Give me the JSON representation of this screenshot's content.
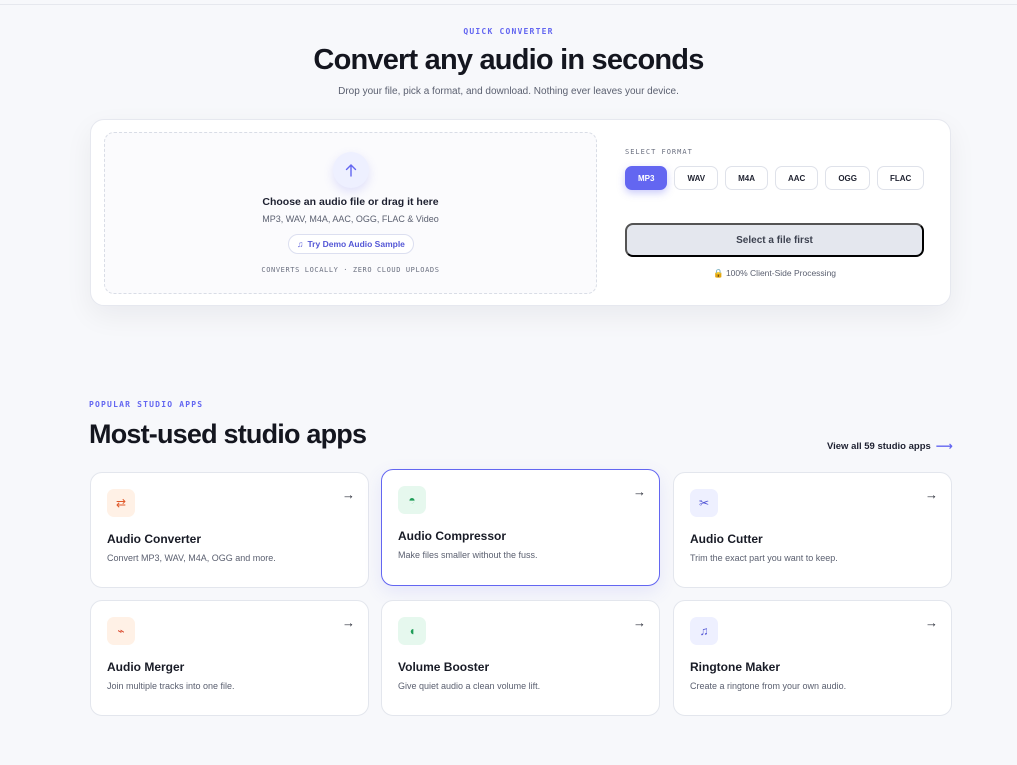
{
  "converter": {
    "eyebrow": "QUICK CONVERTER",
    "title": "Convert any audio in seconds",
    "subtitle": "Drop your file, pick a format, and download. Nothing ever leaves your device.",
    "dropzone": {
      "upload_icon": "up-arrow-icon",
      "title": "Choose an audio file or drag it here",
      "formats": "MP3, WAV, M4A, AAC, OGG, FLAC & Video",
      "demo_label": "Try Demo Audio Sample",
      "demo_icon": "music-note-icon",
      "note": "CONVERTS LOCALLY · ZERO CLOUD UPLOADS"
    },
    "format_label": "SELECT FORMAT",
    "formats": [
      "MP3",
      "WAV",
      "M4A",
      "AAC",
      "OGG",
      "FLAC"
    ],
    "selected_format": "MP3",
    "action_label": "Select a file first",
    "client_note": "100% Client-Side Processing",
    "client_icon": "lock-icon",
    "accent": "#6366f1"
  },
  "apps": {
    "eyebrow": "POPULAR STUDIO APPS",
    "title": "Most-used studio apps",
    "view_all": "View all 59 studio apps",
    "items": [
      {
        "name": "Audio Converter",
        "desc": "Convert MP3, WAV, M4A, OGG and more.",
        "icon": "swap-arrows-icon",
        "glyph": "⇄",
        "bg": "#fff1e6",
        "fg": "#e0592a"
      },
      {
        "name": "Audio Compressor",
        "desc": "Make files smaller without the fuss.",
        "icon": "compress-icon",
        "glyph": "◓",
        "bg": "#e6f8ee",
        "fg": "#1f9d58"
      },
      {
        "name": "Audio Cutter",
        "desc": "Trim the exact part you want to keep.",
        "icon": "scissors-icon",
        "glyph": "✂",
        "bg": "#eef0ff",
        "fg": "#5457d6"
      },
      {
        "name": "Audio Merger",
        "desc": "Join multiple tracks into one file.",
        "icon": "merge-icon",
        "glyph": "⌁",
        "bg": "#fff1e6",
        "fg": "#d9462a"
      },
      {
        "name": "Volume Booster",
        "desc": "Give quiet audio a clean volume lift.",
        "icon": "volume-icon",
        "glyph": "◖",
        "bg": "#e6f8ee",
        "fg": "#1f9d58"
      },
      {
        "name": "Ringtone Maker",
        "desc": "Create a ringtone from your own audio.",
        "icon": "music-note-icon",
        "glyph": "♫",
        "bg": "#eef0ff",
        "fg": "#5457d6"
      }
    ]
  }
}
